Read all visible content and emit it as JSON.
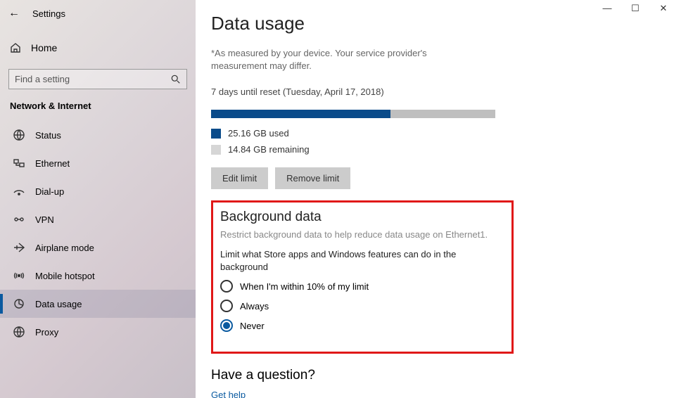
{
  "window": {
    "title": "Settings",
    "controls": {
      "min": "—",
      "max": "☐",
      "close": "✕"
    }
  },
  "sidebar": {
    "home": "Home",
    "search_placeholder": "Find a setting",
    "section": "Network & Internet",
    "items": [
      {
        "icon": "status-icon",
        "label": "Status"
      },
      {
        "icon": "ethernet-icon",
        "label": "Ethernet"
      },
      {
        "icon": "dialup-icon",
        "label": "Dial-up"
      },
      {
        "icon": "vpn-icon",
        "label": "VPN"
      },
      {
        "icon": "airplane-icon",
        "label": "Airplane mode"
      },
      {
        "icon": "hotspot-icon",
        "label": "Mobile hotspot"
      },
      {
        "icon": "data-usage-icon",
        "label": "Data usage"
      },
      {
        "icon": "proxy-icon",
        "label": "Proxy"
      }
    ],
    "active_index": 6
  },
  "main": {
    "title": "Data usage",
    "note": "*As measured by your device. Your service provider's measurement may differ.",
    "reset_info": "7 days until reset (Tuesday, April 17, 2018)",
    "progress_percent": 63,
    "used_text": "25.16 GB used",
    "remaining_text": "14.84 GB remaining",
    "edit_btn": "Edit limit",
    "remove_btn": "Remove limit",
    "bg_section": {
      "title": "Background data",
      "desc": "Restrict background data to help reduce data usage on Ethernet1.",
      "option_title": "Limit what Store apps and Windows features can do in the background",
      "options": [
        "When I'm within 10% of my limit",
        "Always",
        "Never"
      ],
      "selected_index": 2
    },
    "question": {
      "title": "Have a question?",
      "link": "Get help"
    }
  }
}
